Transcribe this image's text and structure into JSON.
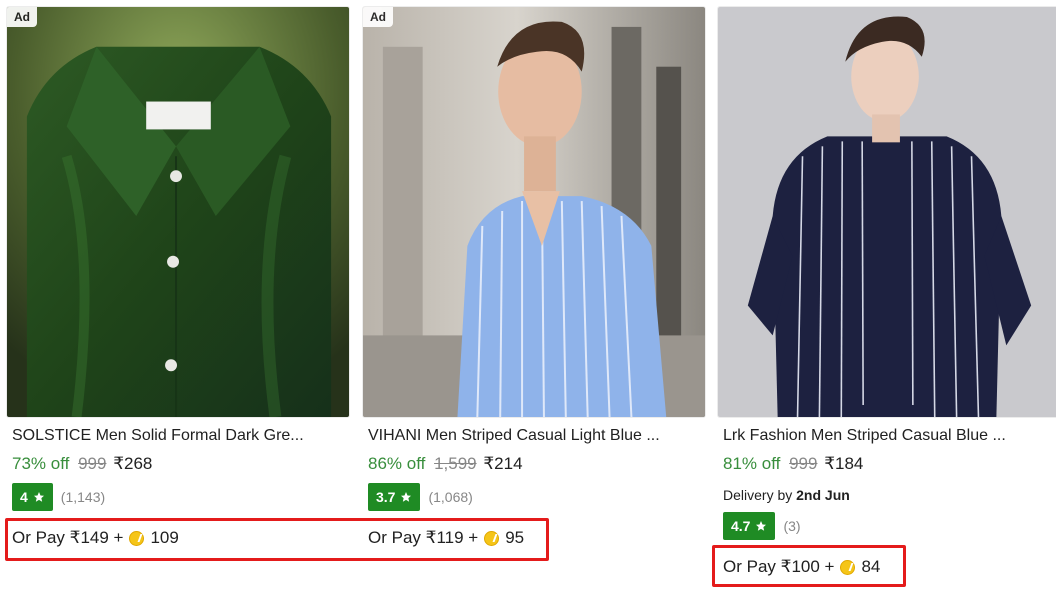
{
  "products": [
    {
      "ad_label": "Ad",
      "title": "SOLSTICE Men Solid Formal Dark Gre...",
      "discount": "73% off",
      "mrp": "999",
      "price": "₹268",
      "rating": "4",
      "rating_count": "(1,143)",
      "pay_text": "Or Pay ₹149 +",
      "coins": "109",
      "image_desc": "dark-green-satin-shirt"
    },
    {
      "ad_label": "Ad",
      "title": "VIHANI Men Striped Casual Light Blue ...",
      "discount": "86% off",
      "mrp": "1,599",
      "price": "₹214",
      "rating": "3.7",
      "rating_count": "(1,068)",
      "pay_text": "Or Pay ₹119 +",
      "coins": "95",
      "image_desc": "light-blue-striped-shirt-model"
    },
    {
      "title": "Lrk Fashion Men Striped Casual Blue ...",
      "discount": "81% off",
      "mrp": "999",
      "price": "₹184",
      "delivery_prefix": "Delivery by",
      "delivery_date": "2nd Jun",
      "rating": "4.7",
      "rating_count": "(3)",
      "pay_text": "Or Pay ₹100 +",
      "coins": "84",
      "image_desc": "navy-striped-shirt-model"
    }
  ],
  "colors": {
    "discount_green": "#388e3c",
    "rating_green": "#1f8b24",
    "highlight_red": "#e41b1b",
    "coin_gold": "#f5c518"
  }
}
